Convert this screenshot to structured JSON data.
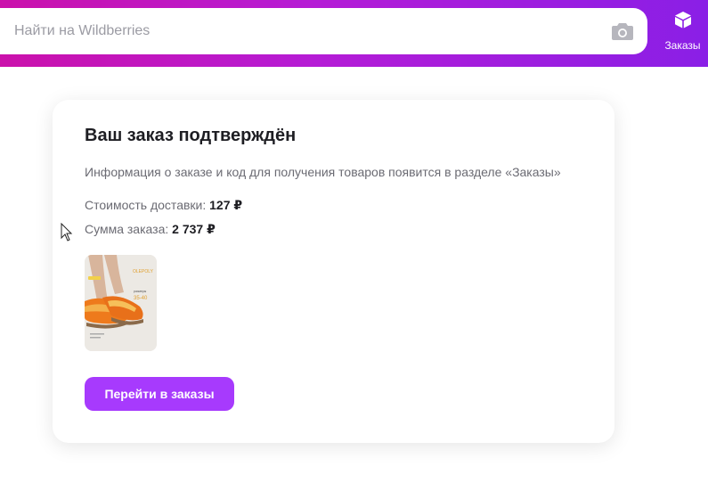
{
  "header": {
    "search": {
      "placeholder": "Найти на Wildberries"
    },
    "orders_label": "Заказы"
  },
  "card": {
    "title": "Ваш заказ подтверждён",
    "info": "Информация о заказе и код для получения товаров появится в разделе «Заказы»",
    "delivery_label": "Стоимость доставки:",
    "delivery_value": "127 ₽",
    "total_label": "Сумма заказа:",
    "total_value": "2 737 ₽",
    "product_image": {
      "brand": "OLEPOLY",
      "sizes_label": "размеры",
      "sizes": "35-40"
    },
    "button_label": "Перейти в заказы"
  },
  "colors": {
    "header_gradient_start": "#cb11ab",
    "header_gradient_end": "#8a1fe6",
    "button": "#a73afd"
  },
  "icons": [
    "camera-icon",
    "box-icon",
    "mouse-cursor-icon"
  ]
}
